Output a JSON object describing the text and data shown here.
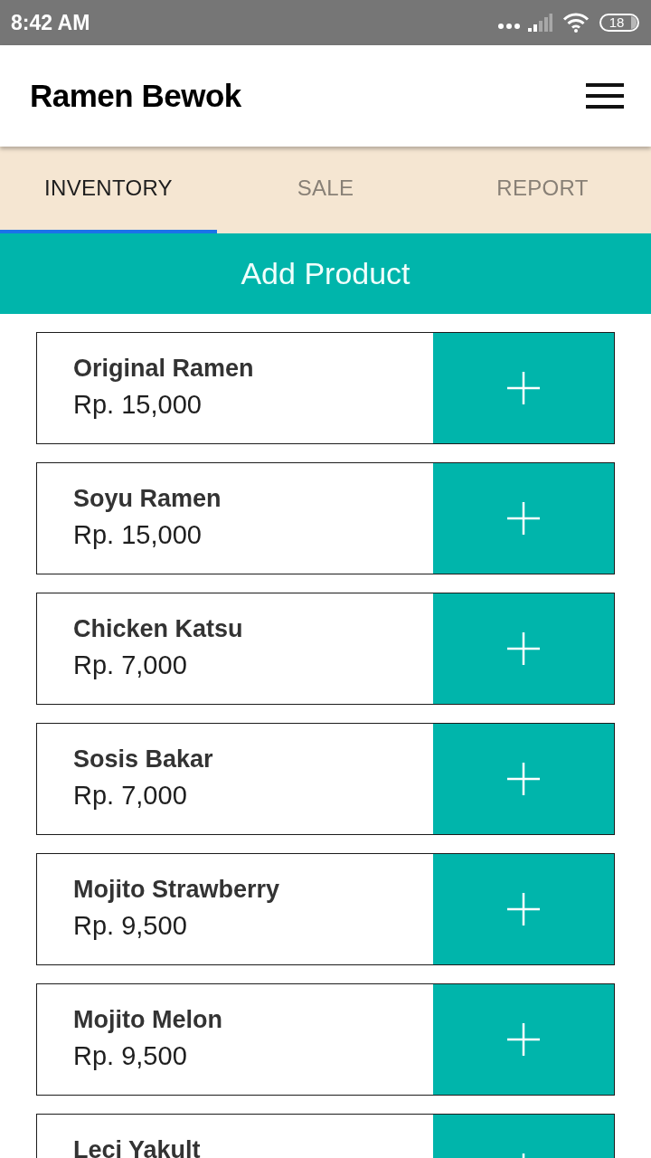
{
  "status_bar": {
    "time": "8:42 AM",
    "battery": "18"
  },
  "app_bar": {
    "title": "Ramen Bewok"
  },
  "tabs": [
    {
      "label": "INVENTORY",
      "selected": true
    },
    {
      "label": "SALE",
      "selected": false
    },
    {
      "label": "REPORT",
      "selected": false
    }
  ],
  "add_product_button": {
    "label": "Add Product"
  },
  "products": [
    {
      "name": "Original Ramen",
      "price": "Rp. 15,000"
    },
    {
      "name": "Soyu Ramen",
      "price": "Rp. 15,000"
    },
    {
      "name": "Chicken Katsu",
      "price": "Rp. 7,000"
    },
    {
      "name": "Sosis Bakar",
      "price": "Rp. 7,000"
    },
    {
      "name": "Mojito Strawberry",
      "price": "Rp. 9,500"
    },
    {
      "name": "Mojito Melon",
      "price": "Rp. 9,500"
    },
    {
      "name": "Leci Yakult"
    }
  ]
}
